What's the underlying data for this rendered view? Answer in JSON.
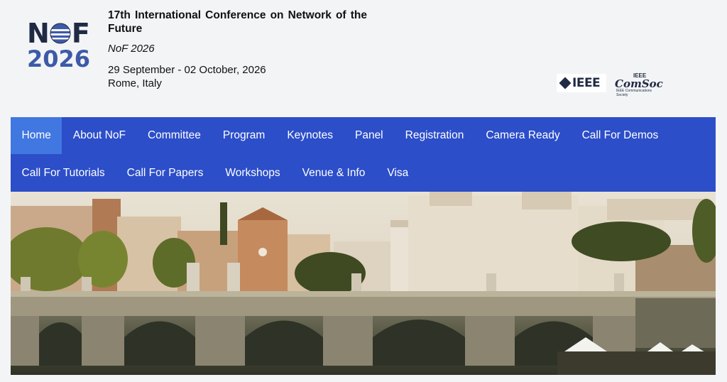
{
  "logo": {
    "letter_n": "N",
    "letter_f": "F",
    "year": "2026"
  },
  "conference": {
    "title": "17th International Conference on Network of the Future",
    "short": "NoF 2026",
    "dates": "29 September - 02 October, 2026",
    "place": "Rome, Italy"
  },
  "sponsors": {
    "ieee": "IEEE",
    "comsoc_small": "IEEE",
    "comsoc": "ComSoc",
    "comsoc_tag": "IEEE Communications Society"
  },
  "nav": {
    "row1": [
      "Home",
      "About NoF",
      "Committee",
      "Program",
      "Keynotes",
      "Panel",
      "Registration",
      "Camera Ready",
      "Call For Demos"
    ],
    "row2": [
      "Call For Tutorials",
      "Call For Papers",
      "Workshops",
      "Venue & Info",
      "Visa"
    ],
    "active": "Home"
  },
  "colors": {
    "nav_bg": "#2c4ec9",
    "nav_active": "#4077e0",
    "logo_dark": "#1f2a44",
    "logo_blue": "#3d5aa8"
  }
}
